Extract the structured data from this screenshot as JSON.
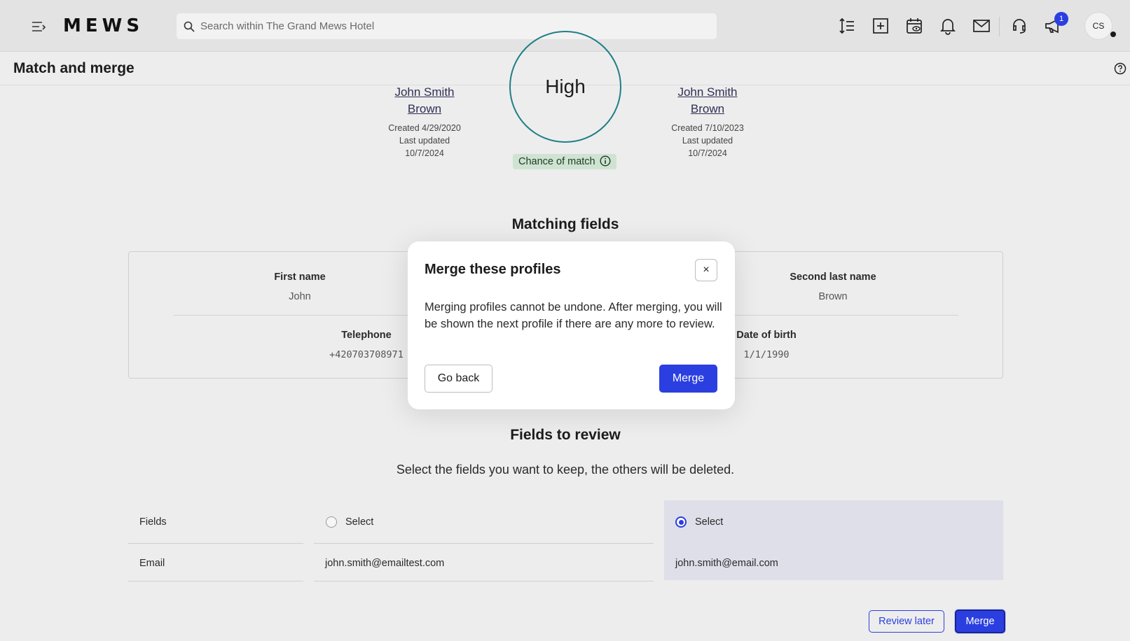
{
  "app": {
    "logo": "MEWS"
  },
  "search": {
    "placeholder": "Search within The Grand Mews Hotel"
  },
  "toolbar": {
    "icons": [
      "sort-icon",
      "add-icon",
      "calendar-view-icon",
      "bell-icon",
      "mail-icon",
      "headset-icon",
      "megaphone-icon"
    ],
    "announcement_badge": "1",
    "avatar_initials": "CS"
  },
  "page": {
    "title": "Match and merge"
  },
  "profiles": {
    "left": {
      "name_line1": "John Smith",
      "name_line2": "Brown",
      "created": "Created 4/29/2020",
      "updated_label": "Last updated",
      "updated_date": "10/7/2024"
    },
    "right": {
      "name_line1": "John Smith",
      "name_line2": "Brown",
      "created": "Created 7/10/2023",
      "updated_label": "Last updated",
      "updated_date": "10/7/2024"
    }
  },
  "match": {
    "level": "High",
    "chip_label": "Chance of match"
  },
  "matching_fields": {
    "title": "Matching fields",
    "items": [
      {
        "label": "First name",
        "value": "John"
      },
      {
        "label": "Second last name",
        "value": "Brown"
      },
      {
        "label": "Telephone",
        "value": "+420703708971"
      },
      {
        "label": "Date of birth",
        "value": "1/1/1990"
      }
    ]
  },
  "review": {
    "title": "Fields to review",
    "instruction": "Select the fields you want to keep, the others will be deleted.",
    "header_fields": "Fields",
    "select_left": "Select",
    "select_right": "Select",
    "selected": "right",
    "rows": [
      {
        "field": "Email",
        "left": "john.smith@emailtest.com",
        "right": "john.smith@email.com"
      }
    ]
  },
  "actions": {
    "review_later": "Review later",
    "merge": "Merge"
  },
  "modal": {
    "title": "Merge these profiles",
    "close": "×",
    "body": "Merging profiles cannot be undone. After merging, you will be shown the next profile if there are any more to review.",
    "back": "Go back",
    "confirm": "Merge"
  }
}
